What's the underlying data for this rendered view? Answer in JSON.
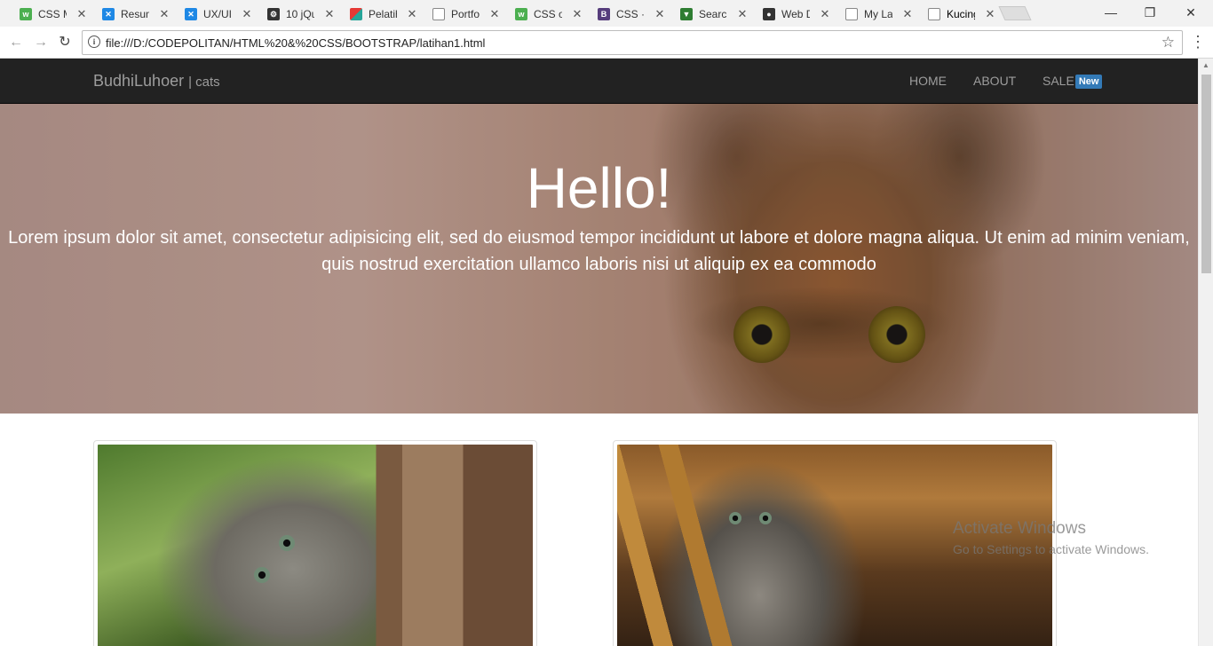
{
  "browser": {
    "tabs": [
      {
        "label": "CSS M",
        "icon": "w3schools-icon",
        "color": "#4caf50"
      },
      {
        "label": "Resum",
        "icon": "xcode-icon",
        "color": "#1e88e5"
      },
      {
        "label": "UX/UI",
        "icon": "xcode-icon",
        "color": "#1e88e5"
      },
      {
        "label": "10 jQu",
        "icon": "gear-icon",
        "color": "#333333"
      },
      {
        "label": "Pelatih",
        "icon": "cube-icon",
        "color": "#e53935"
      },
      {
        "label": "Portfo",
        "icon": "page-icon",
        "color": "#888888"
      },
      {
        "label": "CSS ol",
        "icon": "w3schools-icon",
        "color": "#4caf50"
      },
      {
        "label": "CSS ·",
        "icon": "bootstrap-icon",
        "color": "#563d7c"
      },
      {
        "label": "Search",
        "icon": "funnel-icon",
        "color": "#2e7d32"
      },
      {
        "label": "Web D",
        "icon": "camera-icon",
        "color": "#333333"
      },
      {
        "label": "My La",
        "icon": "page-icon",
        "color": "#888888"
      },
      {
        "label": "Kucing",
        "icon": "page-icon",
        "color": "#888888",
        "active": true
      }
    ],
    "url": "file:///D:/CODEPOLITAN/HTML%20&%20CSS/BOOTSTRAP/latihan1.html"
  },
  "site": {
    "brand": "BudhiLuhoer",
    "brand_sub": "| cats",
    "nav": {
      "home": "HOME",
      "about": "ABOUT",
      "sale": "SALE",
      "sale_badge": "New"
    },
    "hero": {
      "title": "Hello!",
      "text": "Lorem ipsum dolor sit amet, consectetur adipisicing elit, sed do eiusmod tempor incididunt ut labore et dolore magna aliqua. Ut enim ad minim veniam, quis nostrud exercitation ullamco laboris nisi ut aliquip ex ea commodo"
    }
  },
  "watermark": {
    "title": "Activate Windows",
    "subtitle": "Go to Settings to activate Windows."
  }
}
